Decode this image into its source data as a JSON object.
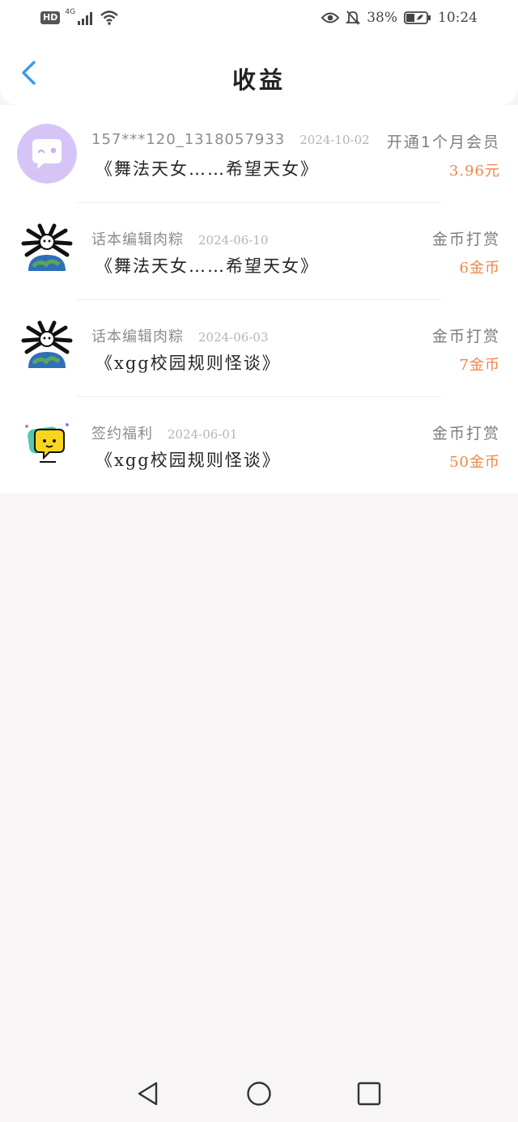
{
  "status_bar": {
    "hd": "HD",
    "network": "4G",
    "battery_percent": "38%",
    "time": "10:24",
    "icons": [
      "signal-icon",
      "wifi-icon",
      "eye-icon",
      "bell-off-icon",
      "battery-icon"
    ]
  },
  "header": {
    "title": "收益",
    "back_icon": "chevron-left-icon"
  },
  "earnings": [
    {
      "user": "157***120_1318057933",
      "date": "2024-10-02",
      "work": "《舞法天女……希望天女》",
      "type": "开通1个月会员",
      "amount": "3.96元",
      "avatar": "chat-bubble-avatar"
    },
    {
      "user": "话本编辑肉粽",
      "date": "2024-06-10",
      "work": "《舞法天女……希望天女》",
      "type": "金币打赏",
      "amount": "6金币",
      "avatar": "earth-creature-avatar"
    },
    {
      "user": "话本编辑肉粽",
      "date": "2024-06-03",
      "work": "《xgg校园规则怪谈》",
      "type": "金币打赏",
      "amount": "7金币",
      "avatar": "earth-creature-avatar"
    },
    {
      "user": "签约福利",
      "date": "2024-06-01",
      "work": "《xgg校园规则怪谈》",
      "type": "金币打赏",
      "amount": "50金币",
      "avatar": "yellow-chat-avatar"
    }
  ],
  "colors": {
    "accent_blue": "#3a9bf0",
    "amount_orange": "#f0864a",
    "avatar_purple": "#d7c4f7"
  },
  "nav_bar": [
    "back-triangle-icon",
    "home-circle-icon",
    "recents-square-icon"
  ]
}
